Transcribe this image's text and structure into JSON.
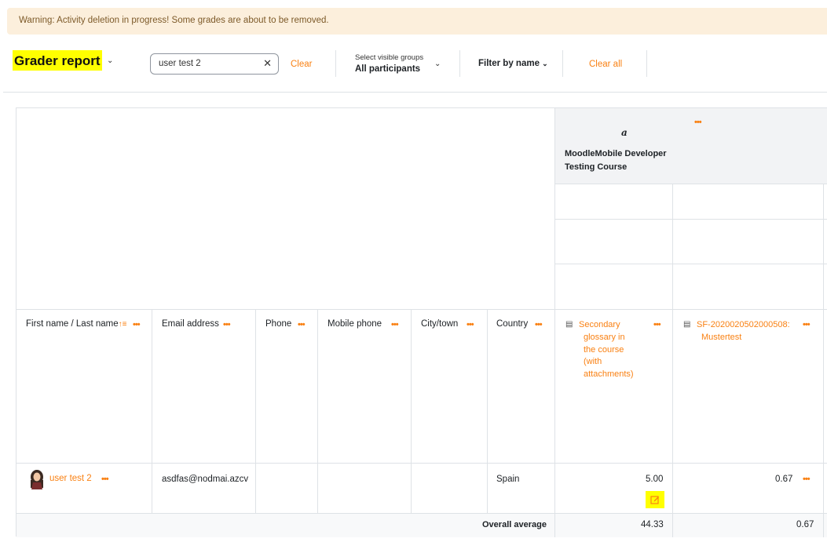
{
  "warning": "Warning: Activity deletion in progress! Some grades are about to be removed.",
  "page": {
    "title": "Grader report"
  },
  "search": {
    "value": "user test 2",
    "clear_label": "Clear"
  },
  "groups": {
    "label": "Select visible groups",
    "value": "All participants"
  },
  "filter": {
    "label": "Filter by name"
  },
  "clear_all_label": "Clear all",
  "course": {
    "icon_letter": "a",
    "name_line1": "MoodleMobile Developer",
    "name_line2": "Testing Course"
  },
  "columns": {
    "name": "First name / Last name",
    "email": "Email address",
    "phone": "Phone",
    "mobile": "Mobile phone",
    "city": "City/town",
    "country": "Country",
    "item1": [
      "Secondary",
      "glossary in",
      "the course",
      "(with",
      "attachments)"
    ],
    "item2": [
      "SF-2020020502000508:",
      "Mustertest"
    ]
  },
  "row": {
    "name": "user test 2",
    "email": "asdfas@nodmai.azcv",
    "country": "Spain",
    "grade1": "5.00",
    "grade2": "0.67"
  },
  "average": {
    "label": "Overall average",
    "grade1": "44.33",
    "grade2": "0.67"
  },
  "colors": {
    "accent": "#f98012",
    "highlight": "#ffff00",
    "warning_bg": "#fcefdc"
  }
}
